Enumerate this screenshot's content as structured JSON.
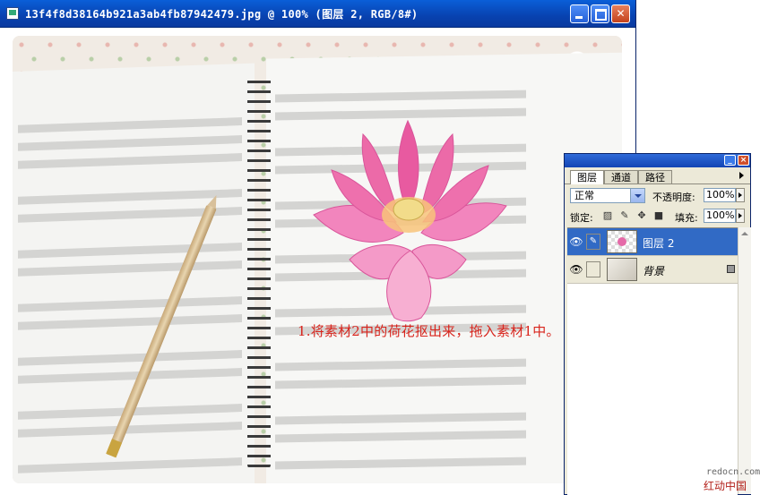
{
  "document": {
    "title": "13f4f8d38164b921a3ab4fb87942479.jpg @ 100% (图层 2, RGB/8#)",
    "caption": "1.将素材2中的荷花抠出来，拖入素材1中。"
  },
  "layers_panel": {
    "tabs": [
      "图层",
      "通道",
      "路径"
    ],
    "blend_mode": "正常",
    "opacity_label": "不透明度:",
    "opacity_value": "100%",
    "lock_label": "锁定:",
    "fill_label": "填充:",
    "fill_value": "100%",
    "layers": [
      {
        "name": "图层 2",
        "selected": true
      },
      {
        "name": "背景",
        "selected": false,
        "locked": true
      }
    ]
  },
  "watermark": {
    "url": "redocn.com",
    "brand": "红动中国"
  },
  "colors": {
    "caption": "#d8241c",
    "selection": "#316ac5",
    "title_bar": "#0842b0"
  }
}
